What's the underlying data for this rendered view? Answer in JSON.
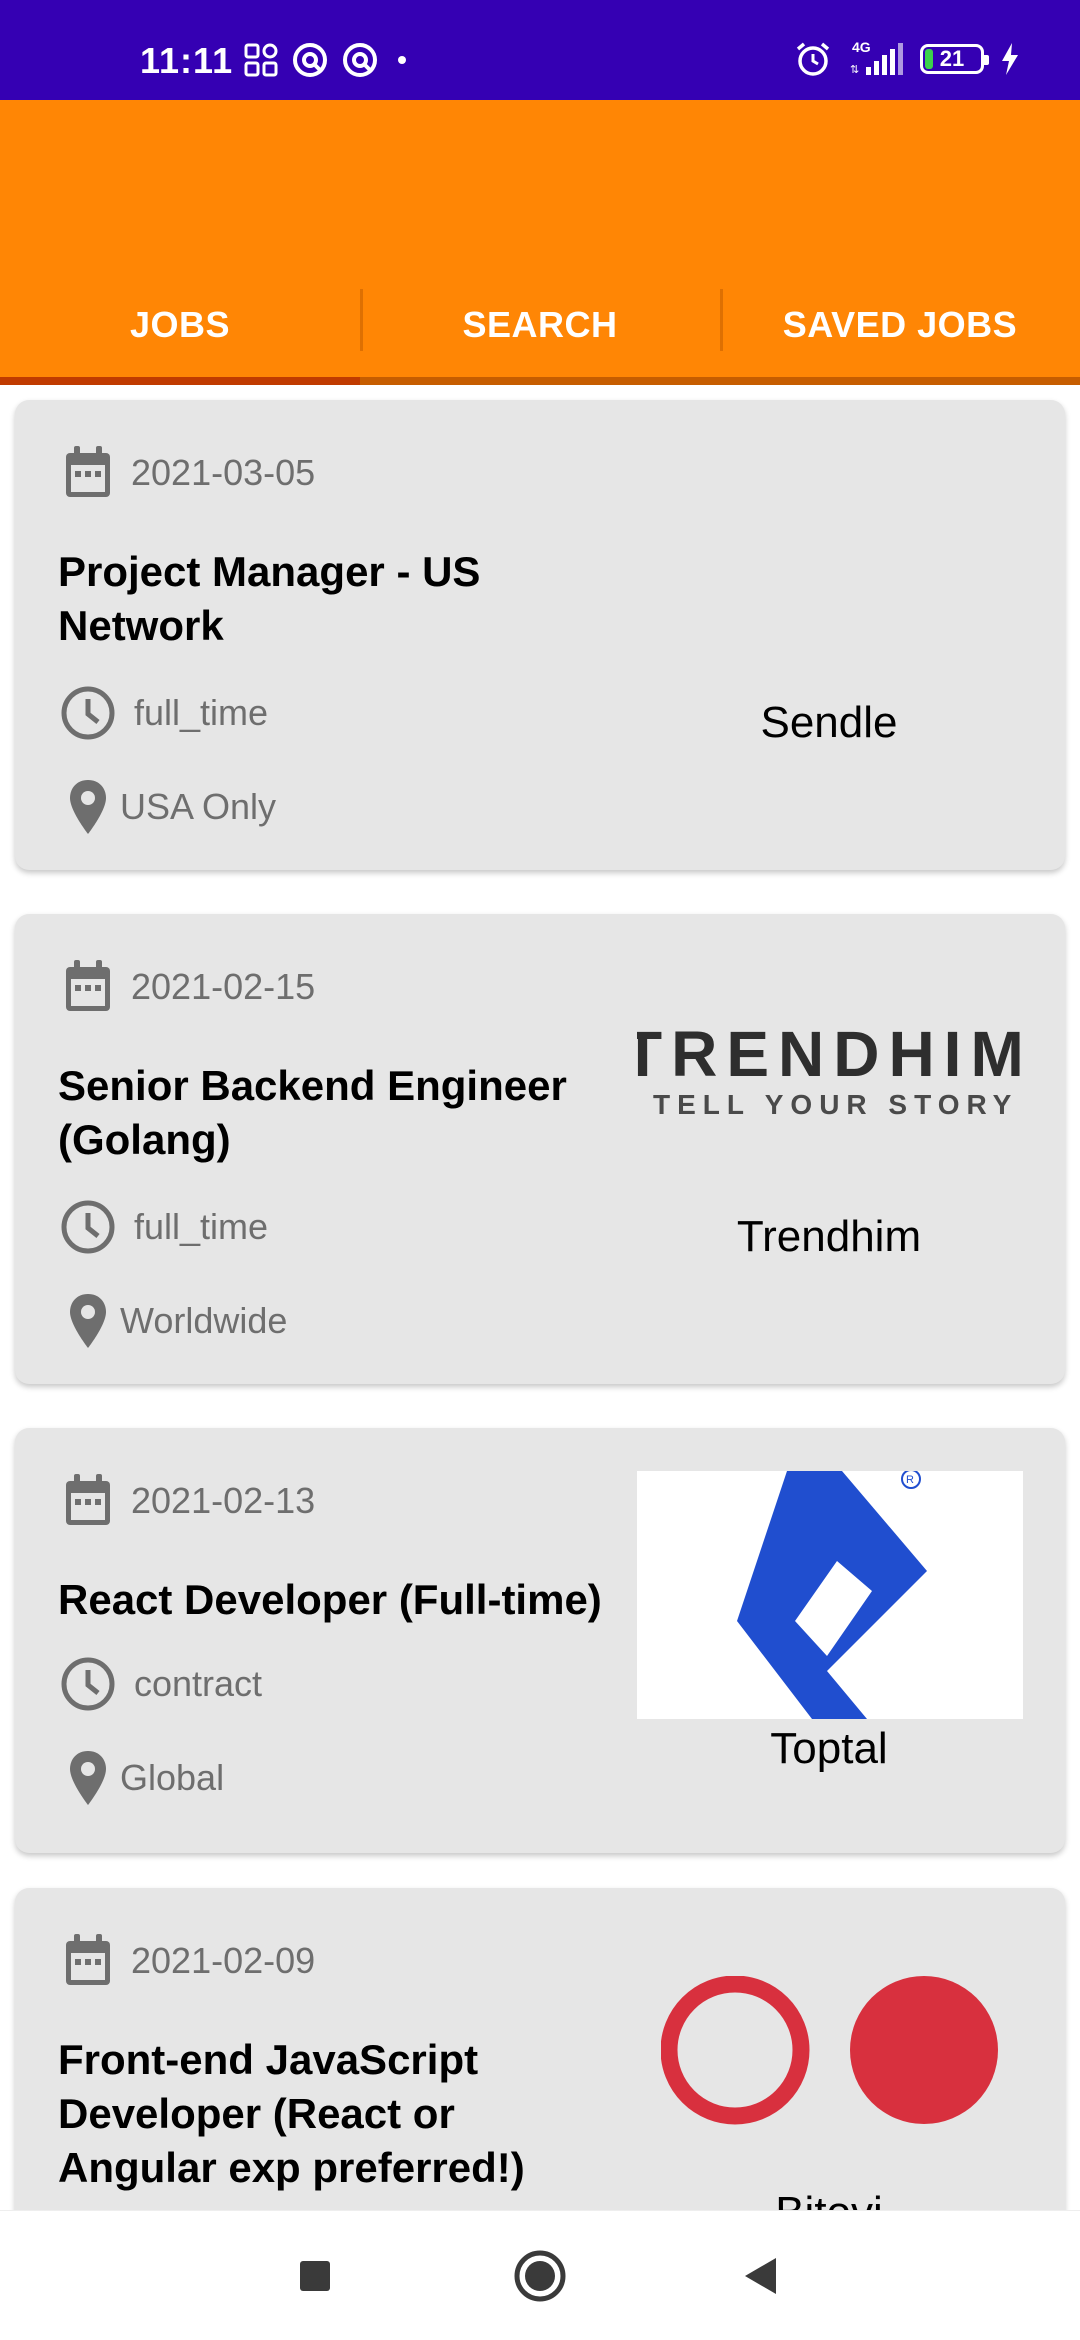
{
  "status_bar": {
    "time": "11:11",
    "network": "4G",
    "battery": "21"
  },
  "tabs": [
    {
      "label": "JOBS",
      "selected": true
    },
    {
      "label": "SEARCH",
      "selected": false
    },
    {
      "label": "SAVED JOBS",
      "selected": false
    }
  ],
  "jobs": [
    {
      "date": "2021-03-05",
      "title": "Project Manager - US Network",
      "job_type": "full_time",
      "location": "USA Only",
      "company": "Sendle",
      "logo": "none"
    },
    {
      "date": "2021-02-15",
      "title": "Senior Backend Engineer (Golang)",
      "job_type": "full_time",
      "location": "Worldwide",
      "company": "Trendhim",
      "logo": "trendhim-logo",
      "logo_text": "TRENDHIM",
      "logo_tagline": "TELL YOUR STORY"
    },
    {
      "date": "2021-02-13",
      "title": "React Developer (Full-time)",
      "job_type": "contract",
      "location": "Global",
      "company": "Toptal",
      "logo": "toptal-logo",
      "logo_color": "#204ecf"
    },
    {
      "date": "2021-02-09",
      "title": "Front-end JavaScript Developer (React or Angular exp preferred!)",
      "company": "Bitovi",
      "logo": "bitovi-logo",
      "logo_color": "#d8303e"
    }
  ],
  "icons": {
    "date": "calendar-icon",
    "job_type": "clock-icon",
    "location": "location-pin-icon"
  },
  "colors": {
    "status_bar": "#3500b3",
    "app_bar": "#ff8605",
    "card": "#e6e6e6"
  }
}
